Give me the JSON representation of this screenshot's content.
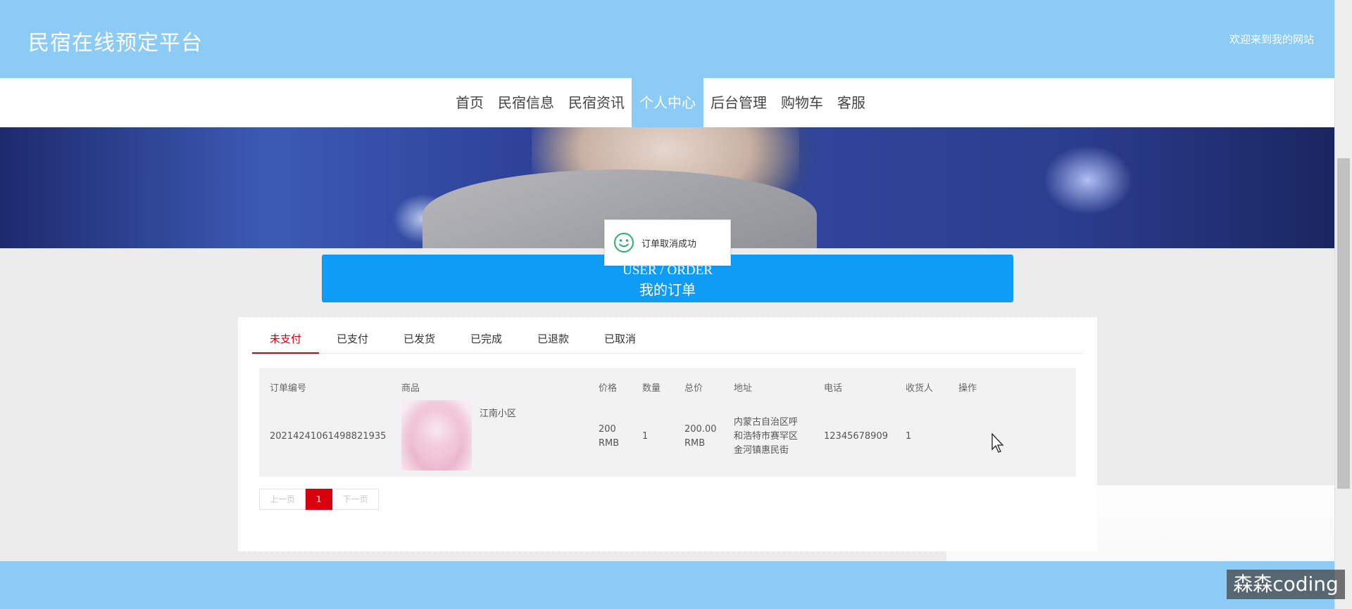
{
  "header": {
    "site_title": "民宿在线预定平台",
    "welcome": "欢迎来到我的网站"
  },
  "nav": {
    "items": [
      {
        "label": "首页"
      },
      {
        "label": "民宿信息"
      },
      {
        "label": "民宿资讯"
      },
      {
        "label": "个人中心",
        "active": true
      },
      {
        "label": "后台管理"
      },
      {
        "label": "购物车"
      },
      {
        "label": "客服"
      }
    ]
  },
  "toast": {
    "icon": "smile-icon",
    "message": "订单取消成功"
  },
  "order_header": {
    "en": "USER / ORDER",
    "cn": "我的订单"
  },
  "tabs": [
    {
      "label": "未支付",
      "active": true
    },
    {
      "label": "已支付"
    },
    {
      "label": "已发货"
    },
    {
      "label": "已完成"
    },
    {
      "label": "已退款"
    },
    {
      "label": "已取消"
    }
  ],
  "table": {
    "headers": [
      "订单编号",
      "商品",
      "价格",
      "数量",
      "总价",
      "地址",
      "电话",
      "收货人",
      "操作"
    ],
    "rows": [
      {
        "order_no": "20214241061498821935",
        "product": "江南小区",
        "price": "200",
        "price_unit": "RMB",
        "qty": "1",
        "total": "200.00",
        "total_unit": "RMB",
        "address_line1": "内蒙古自治区呼",
        "address_line2": "和浩特市赛罕区",
        "address_line3": "金河镇惠民街",
        "phone": "12345678909",
        "receiver": "1"
      }
    ]
  },
  "pager": {
    "prev": "上一页",
    "current": "1",
    "next": "下一页"
  },
  "watermark": "森森coding",
  "colors": {
    "header_bg": "#8ccbf6",
    "accent_red": "#d6000f",
    "order_header_bg": "#0e9cf7"
  }
}
